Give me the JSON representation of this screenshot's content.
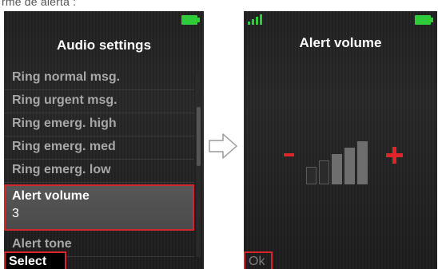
{
  "caption": "rme de alerta :",
  "left_screen": {
    "title": "Audio settings",
    "items": [
      {
        "label": "Ring normal msg."
      },
      {
        "label": "Ring urgent msg."
      },
      {
        "label": "Ring emerg. high"
      },
      {
        "label": "Ring emerg. med"
      },
      {
        "label": "Ring emerg. low"
      }
    ],
    "selected_item": {
      "label": "Alert volume",
      "value": "3"
    },
    "after_items": [
      {
        "label": "Alert tone"
      }
    ],
    "softkey_label": "Select",
    "status_icons": [
      "battery-icon"
    ]
  },
  "transition_icon": "arrow-right-icon",
  "right_screen": {
    "title": "Alert volume",
    "volume_level": 3,
    "volume_max": 5,
    "minus_symbol": "-",
    "plus_symbol": "+",
    "softkey_label": "Ok",
    "status_icons": [
      "signal-icon",
      "battery-icon"
    ]
  },
  "colors": {
    "accent_red": "#d4262b",
    "battery_green": "#2fcc3a",
    "bar_active": "#6e6e6e",
    "bar_inactive": "#2b2b2b",
    "bar_inactive_border": "#5a5a5a"
  }
}
